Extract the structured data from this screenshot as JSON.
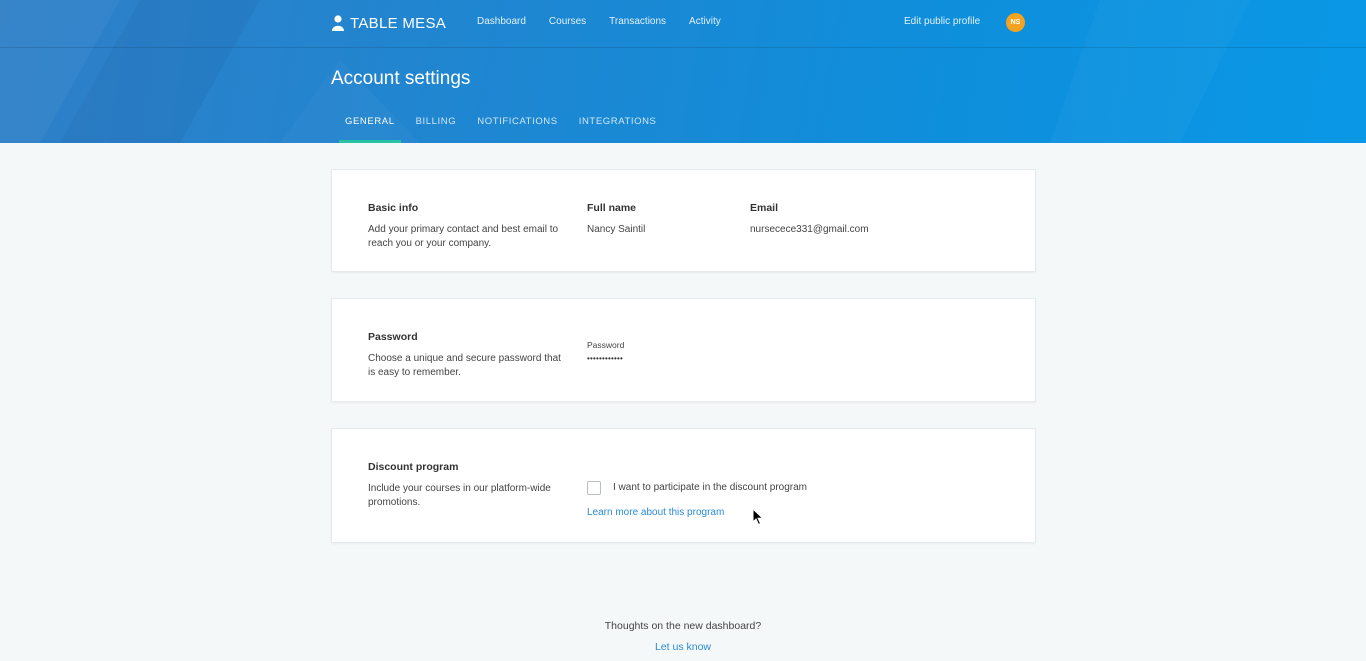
{
  "header": {
    "brand": "TABLE MESA",
    "nav": [
      "Dashboard",
      "Courses",
      "Transactions",
      "Activity"
    ],
    "edit_profile": "Edit public profile",
    "avatar_initials": "NS",
    "avatar_color": "#f4a321"
  },
  "page": {
    "title": "Account settings",
    "tabs": [
      "GENERAL",
      "BILLING",
      "NOTIFICATIONS",
      "INTEGRATIONS"
    ],
    "active_tab": "GENERAL"
  },
  "basic_info": {
    "title": "Basic info",
    "description": "Add your primary contact and best email to reach you or your company.",
    "full_name_label": "Full name",
    "full_name": "Nancy Saintil",
    "email_label": "Email",
    "email": "nursecece331@gmail.com"
  },
  "password": {
    "title": "Password",
    "description": "Choose a unique and secure password that is easy to remember.",
    "label": "Password",
    "value": "••••••••••••"
  },
  "discount": {
    "title": "Discount program",
    "description": "Include your courses in our platform-wide promotions.",
    "checkbox_label": "I want to participate in the discount program",
    "checked": false,
    "link": "Learn more about this program"
  },
  "footer": {
    "question": "Thoughts on the new dashboard?",
    "link": "Let us know"
  },
  "colors": {
    "accent": "#2a8bd6",
    "tab_underline": "#27c3a4"
  }
}
